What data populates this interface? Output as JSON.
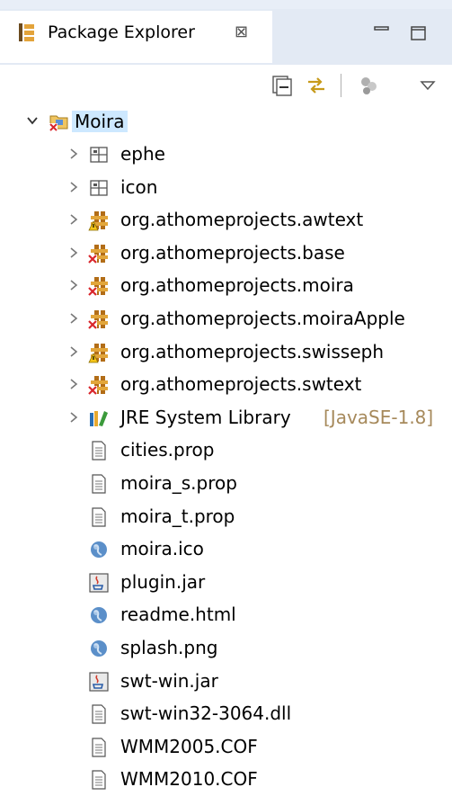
{
  "view": {
    "title": "Package Explorer",
    "close_glyph": "⊠",
    "minimize_icon": "minimize-icon",
    "maximize_icon": "maximize-icon"
  },
  "toolbar": {
    "buttons": [
      "collapse-all-icon",
      "link-with-editor-icon",
      "filter-icon",
      "view-menu-icon"
    ]
  },
  "tree": {
    "project": {
      "label": "Moira",
      "icon": "java-project-error-icon",
      "expanded": true
    },
    "items": [
      {
        "label": "ephe",
        "decoration": "",
        "icon": "folder-package-icon",
        "expandable": true
      },
      {
        "label": "icon",
        "decoration": "",
        "icon": "folder-package-icon",
        "expandable": true
      },
      {
        "label": "org.athomeprojects.awtext",
        "decoration": "",
        "icon": "source-folder-warning-icon",
        "expandable": true
      },
      {
        "label": "org.athomeprojects.base",
        "decoration": "",
        "icon": "source-folder-error-icon",
        "expandable": true
      },
      {
        "label": "org.athomeprojects.moira",
        "decoration": "",
        "icon": "source-folder-error-icon",
        "expandable": true
      },
      {
        "label": "org.athomeprojects.moiraApple",
        "decoration": "",
        "icon": "source-folder-error-icon",
        "expandable": true
      },
      {
        "label": "org.athomeprojects.swisseph",
        "decoration": "",
        "icon": "source-folder-warning-icon",
        "expandable": true
      },
      {
        "label": "org.athomeprojects.swtext",
        "decoration": "",
        "icon": "source-folder-error-icon",
        "expandable": true
      },
      {
        "label": "JRE System Library",
        "decoration": "[JavaSE-1.8]",
        "icon": "library-icon",
        "expandable": true
      },
      {
        "label": "cities.prop",
        "decoration": "",
        "icon": "text-file-icon",
        "expandable": false
      },
      {
        "label": "moira_s.prop",
        "decoration": "",
        "icon": "text-file-icon",
        "expandable": false
      },
      {
        "label": "moira_t.prop",
        "decoration": "",
        "icon": "text-file-icon",
        "expandable": false
      },
      {
        "label": "moira.ico",
        "decoration": "",
        "icon": "globe-file-icon",
        "expandable": false
      },
      {
        "label": "plugin.jar",
        "decoration": "",
        "icon": "jar-file-icon",
        "expandable": false
      },
      {
        "label": "readme.html",
        "decoration": "",
        "icon": "globe-file-icon",
        "expandable": false
      },
      {
        "label": "splash.png",
        "decoration": "",
        "icon": "globe-file-icon",
        "expandable": false
      },
      {
        "label": "swt-win.jar",
        "decoration": "",
        "icon": "jar-file-icon",
        "expandable": false
      },
      {
        "label": "swt-win32-3064.dll",
        "decoration": "",
        "icon": "text-file-icon",
        "expandable": false
      },
      {
        "label": "WMM2005.COF",
        "decoration": "",
        "icon": "text-file-icon",
        "expandable": false
      },
      {
        "label": "WMM2010.COF",
        "decoration": "",
        "icon": "text-file-icon",
        "expandable": false
      }
    ]
  },
  "colors": {
    "selection": "#cde8ff",
    "decoration_text": "#a6895b",
    "tab_bar": "#e3eaf4"
  }
}
